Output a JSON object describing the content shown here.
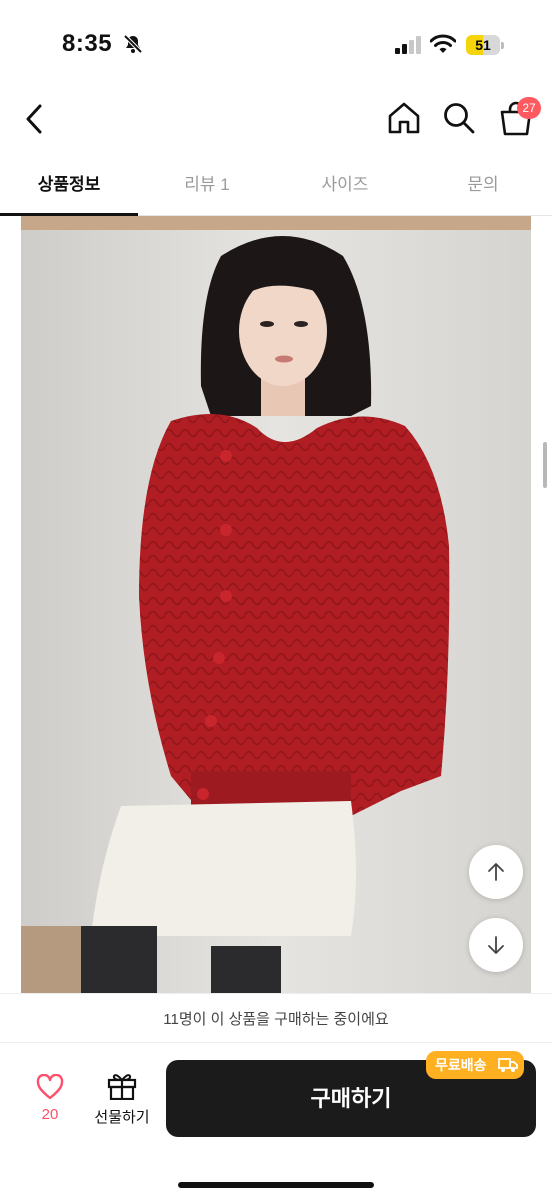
{
  "status_bar": {
    "time": "8:35",
    "battery_level": "51",
    "battery_fraction": 0.51
  },
  "header": {
    "cart_badge": "27"
  },
  "tabs": [
    {
      "label": "상품정보",
      "active": true
    },
    {
      "label": "리뷰 1",
      "active": false
    },
    {
      "label": "사이즈",
      "active": false
    },
    {
      "label": "문의",
      "active": false
    }
  ],
  "notice": {
    "text": "11명이 이 상품을 구매하는 중이에요"
  },
  "bottom_bar": {
    "like_count": "20",
    "gift_label": "선물하기",
    "buy_label": "구매하기",
    "shipping_badge": "무료배송"
  },
  "colors": {
    "accent_like": "#ff4f6d",
    "badge_red": "#ff5a5f",
    "shipping_orange": "#ffb020",
    "buy_button": "#1b1b1b",
    "cardigan_red": "#b01e24"
  },
  "icons": [
    "back-icon",
    "home-icon",
    "search-icon",
    "cart-icon",
    "heart-icon",
    "gift-icon",
    "truck-icon",
    "arrow-up-icon",
    "arrow-down-icon",
    "bell-slash-icon",
    "signal-icon",
    "wifi-icon"
  ]
}
